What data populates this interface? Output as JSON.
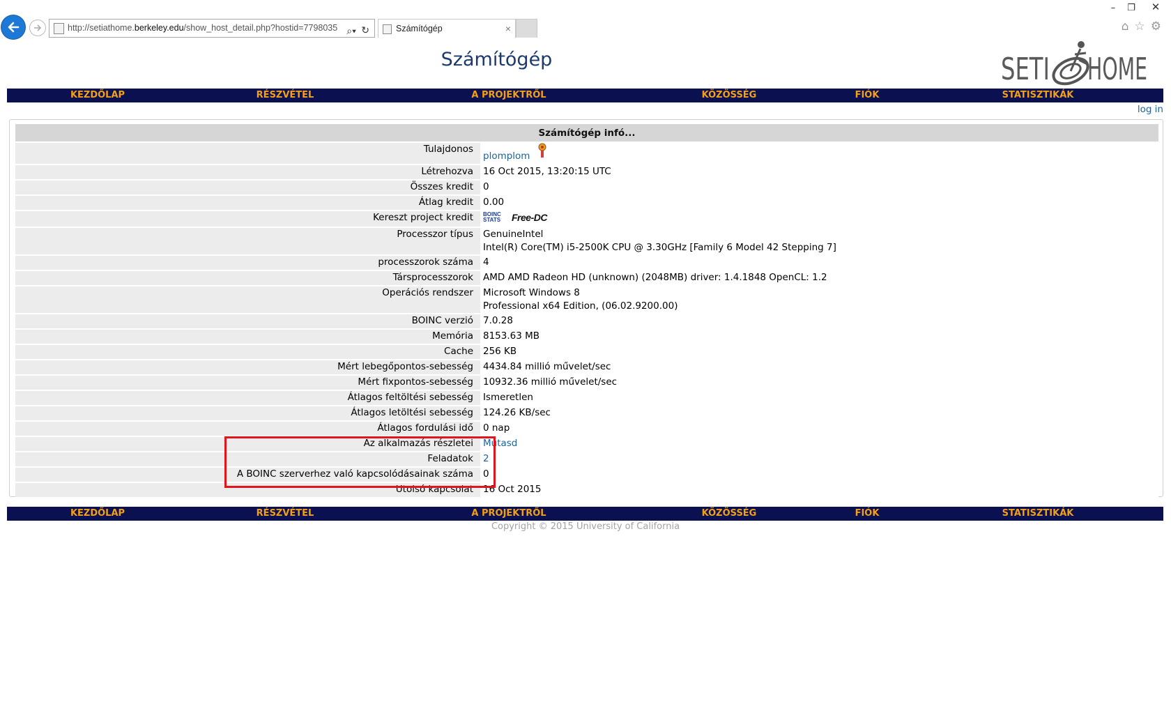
{
  "browser": {
    "url_prefix": "http://setiathome.",
    "url_domain": "berkeley.edu",
    "url_path": "/show_host_detail.php?hostid=7798035",
    "tab_title": "Számítógép",
    "tab_close": "×"
  },
  "page": {
    "title": "Számítógép",
    "logo_text_left": "SETI",
    "logo_text_right": "HOME",
    "log_in": "log in"
  },
  "nav": [
    {
      "label": "KEZDŐLAP"
    },
    {
      "label": "RÉSZVÉTEL"
    },
    {
      "label": "A PROJEKTRŐL"
    },
    {
      "label": "KÖZÖSSÉG"
    },
    {
      "label": "FIÓK"
    },
    {
      "label": "STATISZTIKÁK"
    }
  ],
  "table": {
    "header": "Számítógép infó...",
    "rows": [
      {
        "label": "Tulajdonos",
        "value": "plomplom"
      },
      {
        "label": "Létrehozva",
        "value": "16 Oct 2015, 13:20:15 UTC"
      },
      {
        "label": "Összes kredit",
        "value": "0"
      },
      {
        "label": "Átlag kredit",
        "value": "0.00"
      },
      {
        "label": "Kereszt project kredit",
        "badge1": "BOINC STATS",
        "badge2": "Free-DC"
      },
      {
        "label": "Processzor típus",
        "value": "GenuineIntel",
        "value2": "Intel(R) Core(TM) i5-2500K CPU @ 3.30GHz [Family 6 Model 42 Stepping 7]"
      },
      {
        "label": "processzorok száma",
        "value": "4"
      },
      {
        "label": "Társprocesszorok",
        "value": "AMD AMD Radeon HD (unknown) (2048MB) driver: 1.4.1848 OpenCL: 1.2"
      },
      {
        "label": "Operációs rendszer",
        "value": "Microsoft Windows 8",
        "value2": "Professional x64 Edition, (06.02.9200.00)"
      },
      {
        "label": "BOINC verzió",
        "value": "7.0.28"
      },
      {
        "label": "Memória",
        "value": "8153.63 MB"
      },
      {
        "label": "Cache",
        "value": "256 KB"
      },
      {
        "label": "Mért lebegőpontos-sebesség",
        "value": "4434.84 millió művelet/sec"
      },
      {
        "label": "Mért fixpontos-sebesség",
        "value": "10932.36 millió művelet/sec"
      },
      {
        "label": "Átlagos feltöltési sebesség",
        "value": "Ismeretlen"
      },
      {
        "label": "Átlagos letöltési sebesség",
        "value": "124.26 KB/sec"
      },
      {
        "label": "Átlagos fordulási idő",
        "value": "0 nap"
      },
      {
        "label": "Az alkalmazás részletei",
        "value": "Mutasd"
      },
      {
        "label": "Feladatok",
        "value": "2"
      },
      {
        "label": "A BOINC szerverhez való kapcsolódásainak száma",
        "value": "0"
      },
      {
        "label": "Utolsó kapcsolat",
        "value": "16 Oct 2015"
      }
    ]
  },
  "footer": {
    "copyright": "Copyright © 2015 University of California"
  },
  "colors": {
    "nav_bg": "#0b1050",
    "nav_text": "#f29f1a",
    "link": "#1a64a0",
    "annotation": "#e0161c"
  }
}
